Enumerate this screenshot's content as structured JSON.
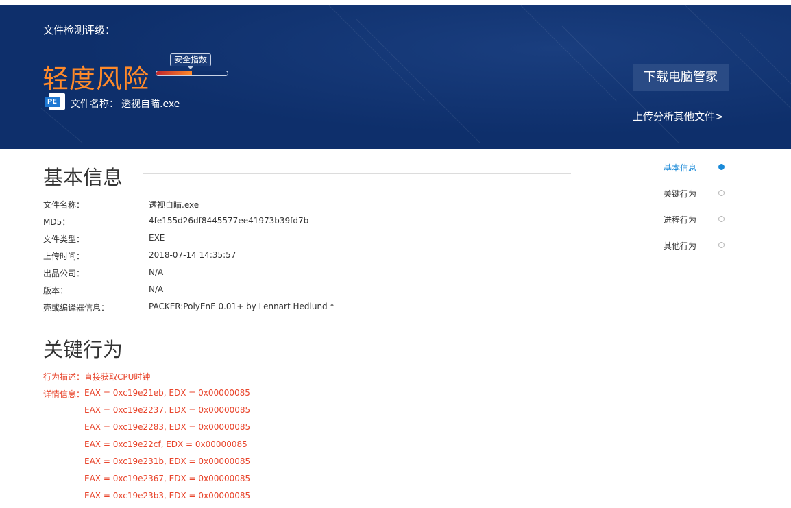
{
  "banner": {
    "rating_label": "文件检测评级：",
    "risk_level": "轻度风险",
    "safety_index_label": "安全指数",
    "safety_index_fraction": 0.5,
    "file_name_label": "文件名称：",
    "file_name": "透视自瞄.exe",
    "pe_icon_text": "PE",
    "download_button": "下载电脑管家",
    "upload_link": "上传分析其他文件>"
  },
  "basic_info": {
    "title": "基本信息",
    "rows": [
      {
        "label": "文件名称：",
        "value": "透视自瞄.exe"
      },
      {
        "label": "MD5：",
        "value": "4fe155d26df8445577ee41973b39fd7b"
      },
      {
        "label": "文件类型：",
        "value": "EXE"
      },
      {
        "label": "上传时间：",
        "value": "2018-07-14 14:35:57"
      },
      {
        "label": "出品公司：",
        "value": "N/A"
      },
      {
        "label": "版本：",
        "value": "N/A"
      },
      {
        "label": "壳或编译器信息：",
        "value": "PACKER:PolyEnE 0.01+ by Lennart Hedlund *"
      }
    ]
  },
  "key_behavior": {
    "title": "关键行为",
    "desc_label": "行为描述：",
    "desc_value": "直接获取CPU时钟",
    "detail_label": "详情信息：",
    "details": [
      "EAX = 0xc19e21eb, EDX = 0x00000085",
      "EAX = 0xc19e2237, EDX = 0x00000085",
      "EAX = 0xc19e2283, EDX = 0x00000085",
      "EAX = 0xc19e22cf, EDX = 0x00000085",
      "EAX = 0xc19e231b, EDX = 0x00000085",
      "EAX = 0xc19e2367, EDX = 0x00000085",
      "EAX = 0xc19e23b3, EDX = 0x00000085"
    ]
  },
  "nav": {
    "items": [
      {
        "label": "基本信息",
        "active": true
      },
      {
        "label": "关键行为",
        "active": false
      },
      {
        "label": "进程行为",
        "active": false
      },
      {
        "label": "其他行为",
        "active": false
      }
    ]
  },
  "colors": {
    "banner_bg": "#0e2f6b",
    "risk_orange": "#ff8a2a",
    "behavior_red": "#e8452c",
    "nav_active": "#1a8ad8"
  }
}
